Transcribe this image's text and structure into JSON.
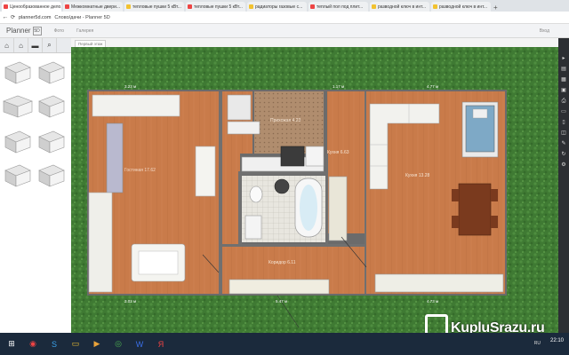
{
  "browser": {
    "tabs": [
      {
        "label": "Ценообразованное дело...",
        "fav": "r"
      },
      {
        "label": "Межкомнатные двери...",
        "fav": "r"
      },
      {
        "label": "тепловые пушки 5 кВт...",
        "fav": "y"
      },
      {
        "label": "тепловые пушки 5 кВт...",
        "fav": "r"
      },
      {
        "label": "радиаторы газовые с...",
        "fav": "y"
      },
      {
        "label": "теплый пол под плит...",
        "fav": "r"
      },
      {
        "label": "разводной ключ в инт...",
        "fav": "y"
      },
      {
        "label": "разводной ключ в инт...",
        "fav": "y"
      }
    ],
    "new_tab": "+",
    "url": "planner5d.com",
    "page_title": "Слово/дачи - Planner 5D"
  },
  "app": {
    "logo": "Planner",
    "logo_badge": "5D",
    "nav": [
      "Фото",
      "Галерея"
    ],
    "login": "Вход"
  },
  "toolbar": {
    "icons": [
      "room-tool-icon",
      "home-icon",
      "furniture-icon",
      "search-icon"
    ],
    "icon_glyphs": [
      "⌂",
      "⌂",
      "▬",
      "⌕"
    ],
    "floor_label": "Первый этаж"
  },
  "floorplan": {
    "rooms": [
      {
        "name": "Гостиная 17.62"
      },
      {
        "name": "Прихожая 4.23"
      },
      {
        "name": "Кухня 6.63"
      },
      {
        "name": "Кухня 13.28"
      },
      {
        "name": "Коридор 6.11"
      }
    ],
    "dimensions": [
      "3.23 м",
      "1.17 м",
      "4.77 м",
      "3.02 м",
      "5.47 м",
      "4.73 м"
    ]
  },
  "right_rail": [
    "▸",
    "▤",
    "▦",
    "▣",
    "⎙",
    "▭",
    "▯",
    "◫",
    "✎",
    "↻",
    "⚙"
  ],
  "taskbar": {
    "clock_time": "22:10",
    "clock_date": "",
    "tray": "RU"
  },
  "watermark": "KupluSrazu.ru"
}
